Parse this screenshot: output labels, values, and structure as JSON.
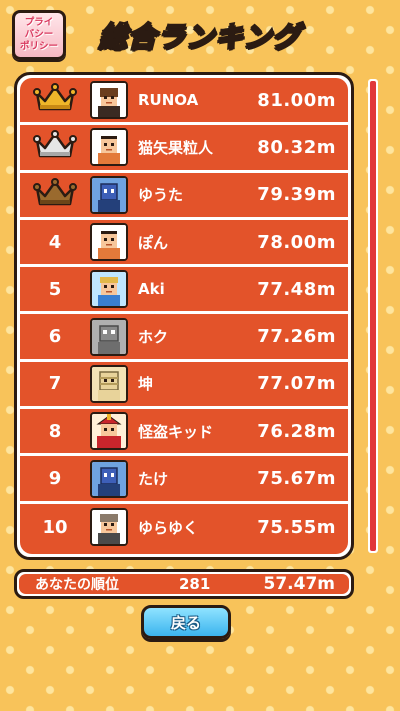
{
  "header": {
    "policy_lines": [
      "プライ",
      "バシー",
      "ポリシー"
    ],
    "title": "総合ランキング"
  },
  "ranking": [
    {
      "rank": "1",
      "medal": "gold",
      "avatar": "brown-hair",
      "name": "RUNOA",
      "score": "81.00m"
    },
    {
      "rank": "2",
      "medal": "silver",
      "avatar": "bald",
      "name": "猫矢果粒人",
      "score": "80.32m"
    },
    {
      "rank": "3",
      "medal": "bronze",
      "avatar": "blue-robot",
      "name": "ゆうた",
      "score": "79.39m"
    },
    {
      "rank": "4",
      "medal": "",
      "avatar": "bald",
      "name": "ぽん",
      "score": "78.00m"
    },
    {
      "rank": "5",
      "medal": "",
      "avatar": "blue-shirt",
      "name": "Aki",
      "score": "77.48m"
    },
    {
      "rank": "6",
      "medal": "",
      "avatar": "gray-robot",
      "name": "ホク",
      "score": "77.26m"
    },
    {
      "rank": "7",
      "medal": "",
      "avatar": "mummy",
      "name": "坤",
      "score": "77.07m"
    },
    {
      "rank": "8",
      "medal": "",
      "avatar": "samurai",
      "name": "怪盗キッド",
      "score": "76.28m"
    },
    {
      "rank": "9",
      "medal": "",
      "avatar": "blue-robot",
      "name": "たけ",
      "score": "75.67m"
    },
    {
      "rank": "10",
      "medal": "",
      "avatar": "gray-hair",
      "name": "ゆらゆく",
      "score": "75.55m"
    }
  ],
  "your_rank": {
    "label": "あなたの順位",
    "rank": "281",
    "score": "57.47m"
  },
  "back_label": "戻る",
  "colors": {
    "board": "#e3532a",
    "gold": "#f0b62a",
    "silver": "#d8d8d8",
    "bronze": "#9a6a2e",
    "background": "#f8c35a"
  }
}
